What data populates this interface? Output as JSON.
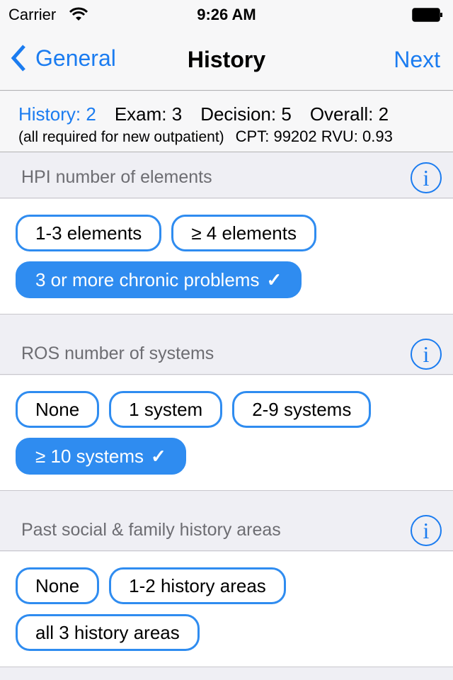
{
  "status_bar": {
    "carrier": "Carrier",
    "time": "9:26 AM"
  },
  "nav": {
    "back_label": "General",
    "title": "History",
    "next_label": "Next"
  },
  "summary": {
    "history": "History: 2",
    "exam": "Exam: 3",
    "decision": "Decision: 5",
    "overall": "Overall: 2",
    "note": "(all required for new outpatient)",
    "cpt": "CPT: 99202 RVU: 0.93"
  },
  "sections": [
    {
      "title": "HPI number of elements",
      "options": [
        {
          "label": "1-3 elements",
          "selected": false
        },
        {
          "label": "≥ 4 elements",
          "selected": false
        },
        {
          "label": "3 or more chronic problems",
          "selected": true
        }
      ]
    },
    {
      "title": "ROS number of systems",
      "options": [
        {
          "label": "None",
          "selected": false
        },
        {
          "label": "1 system",
          "selected": false
        },
        {
          "label": "2-9 systems",
          "selected": false
        },
        {
          "label": "≥ 10 systems",
          "selected": true
        }
      ]
    },
    {
      "title": "Past social & family history areas",
      "options": [
        {
          "label": "None",
          "selected": false
        },
        {
          "label": "1-2 history areas",
          "selected": false
        },
        {
          "label": "all 3 history areas",
          "selected": false
        }
      ]
    }
  ],
  "icons": {
    "info": "i",
    "check": "✓"
  },
  "colors": {
    "accent": "#1b7cf0",
    "chip_border": "#2f8cf0"
  }
}
